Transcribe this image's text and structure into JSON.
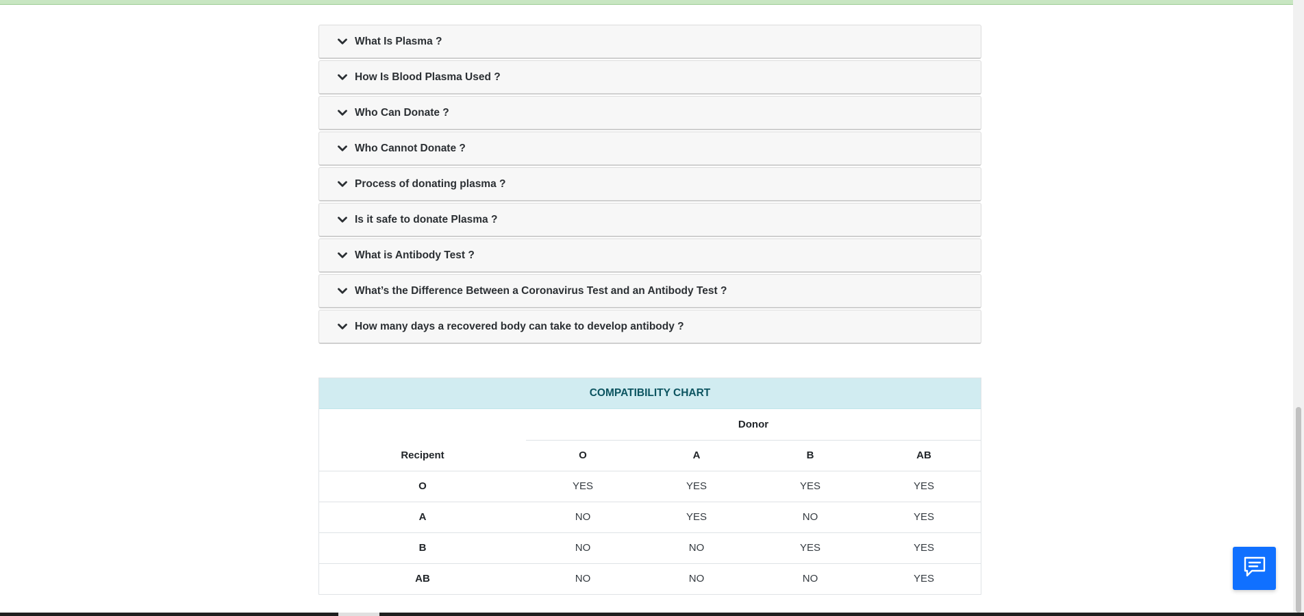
{
  "faq": [
    {
      "question": "What Is Plasma ?"
    },
    {
      "question": "How Is Blood Plasma Used ?"
    },
    {
      "question": "Who Can Donate ?"
    },
    {
      "question": "Who Cannot Donate ?"
    },
    {
      "question": "Process of donating plasma ?"
    },
    {
      "question": "Is it safe to donate Plasma ?"
    },
    {
      "question": "What is Antibody Test ?"
    },
    {
      "question": "What’s the Difference Between a Coronavirus Test and an Antibody Test ?"
    },
    {
      "question": "How many days a recovered body can take to develop antibody ?"
    }
  ],
  "chart": {
    "title": "COMPATIBILITY CHART",
    "donor_label": "Donor",
    "recipient_label": "Recipent",
    "donor_types": [
      "O",
      "A",
      "B",
      "AB"
    ],
    "rows": [
      {
        "recipient": "O",
        "values": [
          "YES",
          "YES",
          "YES",
          "YES"
        ]
      },
      {
        "recipient": "A",
        "values": [
          "NO",
          "YES",
          "NO",
          "YES"
        ]
      },
      {
        "recipient": "B",
        "values": [
          "NO",
          "NO",
          "YES",
          "YES"
        ]
      },
      {
        "recipient": "AB",
        "values": [
          "NO",
          "NO",
          "NO",
          "YES"
        ]
      }
    ]
  },
  "icons": {
    "accordion_toggle": "chevron-down-icon",
    "chat": "chat-bubble-icon"
  },
  "colors": {
    "chart_header_bg": "#d1ecf1",
    "chart_header_text": "#0c5460",
    "chat_button": "#1070ff",
    "top_strip": "#c8e6c2"
  }
}
